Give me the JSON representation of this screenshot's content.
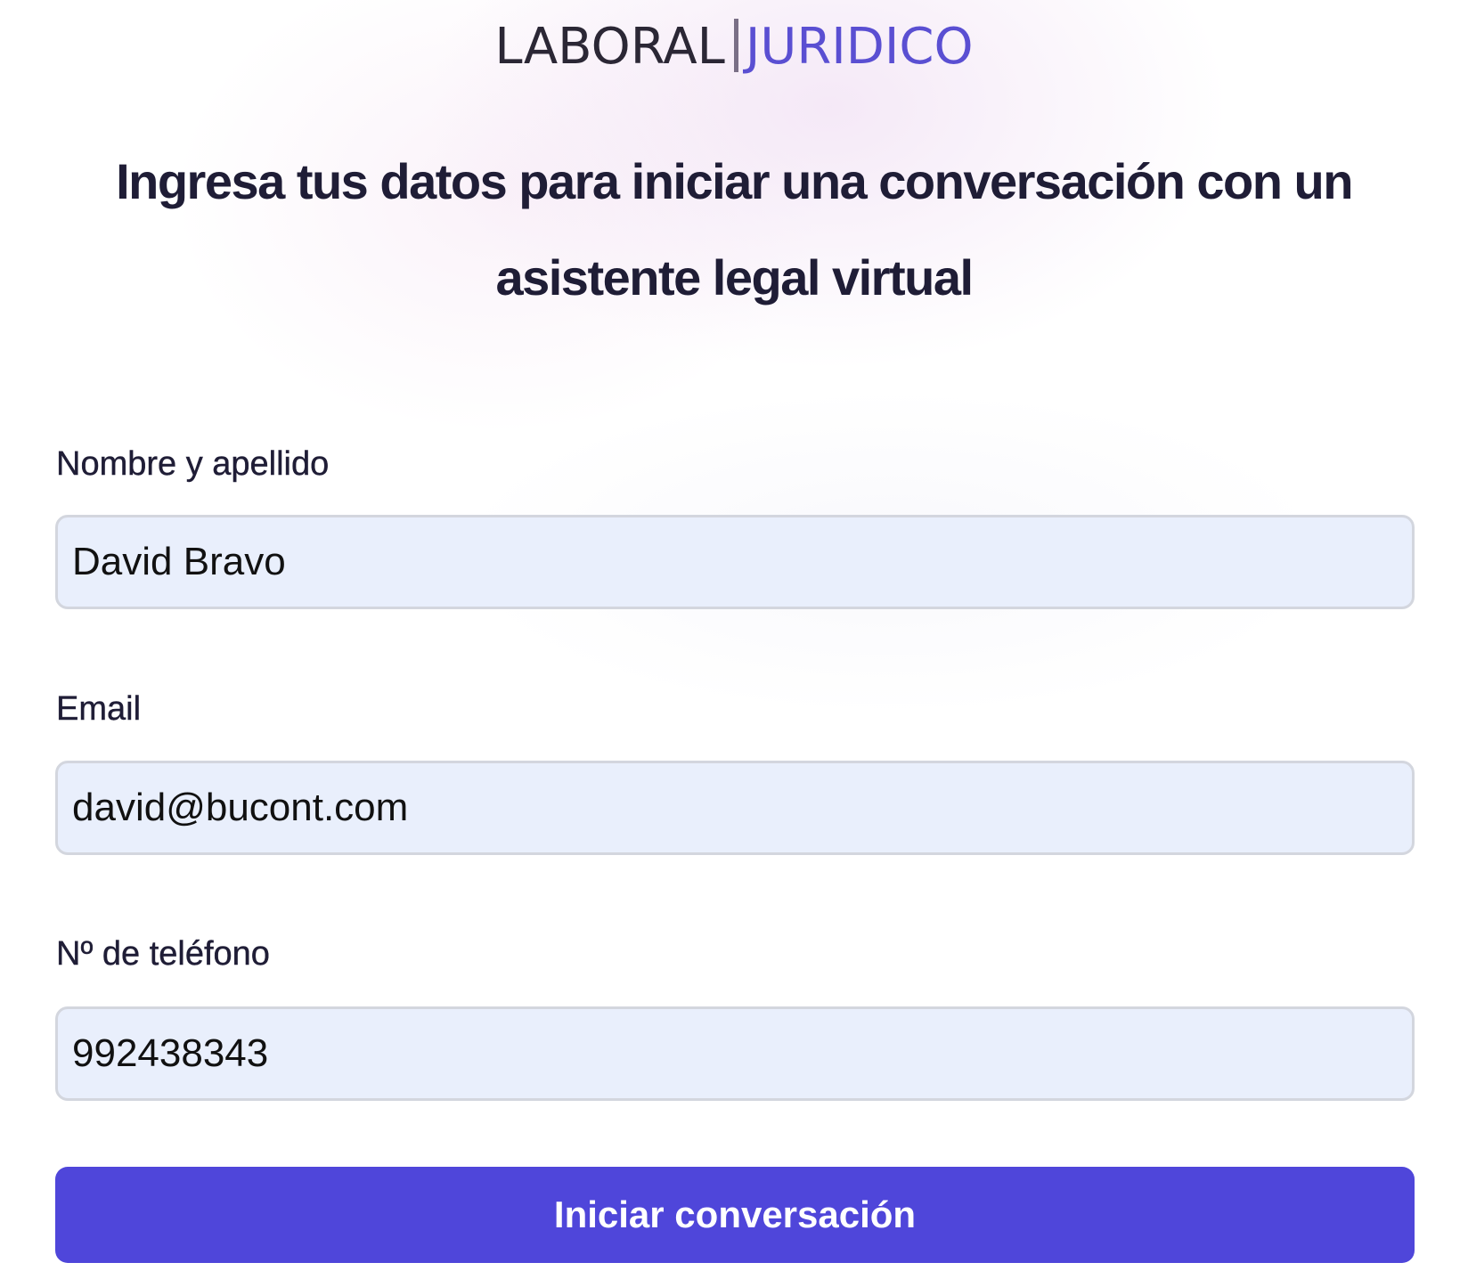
{
  "brand": {
    "left": "LABORAL",
    "right": "JURIDICO",
    "left_color": "#2b2735",
    "right_color": "#5a4fd2"
  },
  "headline": "Ingresa tus datos para iniciar una conversación con un asistente legal virtual",
  "form": {
    "name": {
      "label": "Nombre y apellido",
      "value": "David Bravo"
    },
    "email": {
      "label": "Email",
      "value": "david@bucont.com"
    },
    "phone": {
      "label": "Nº de teléfono",
      "value": "992438343"
    },
    "submit_label": "Iniciar conversación"
  },
  "colors": {
    "accent": "#4f46da",
    "input_background": "#e9effc",
    "text": "#1f1d36"
  }
}
